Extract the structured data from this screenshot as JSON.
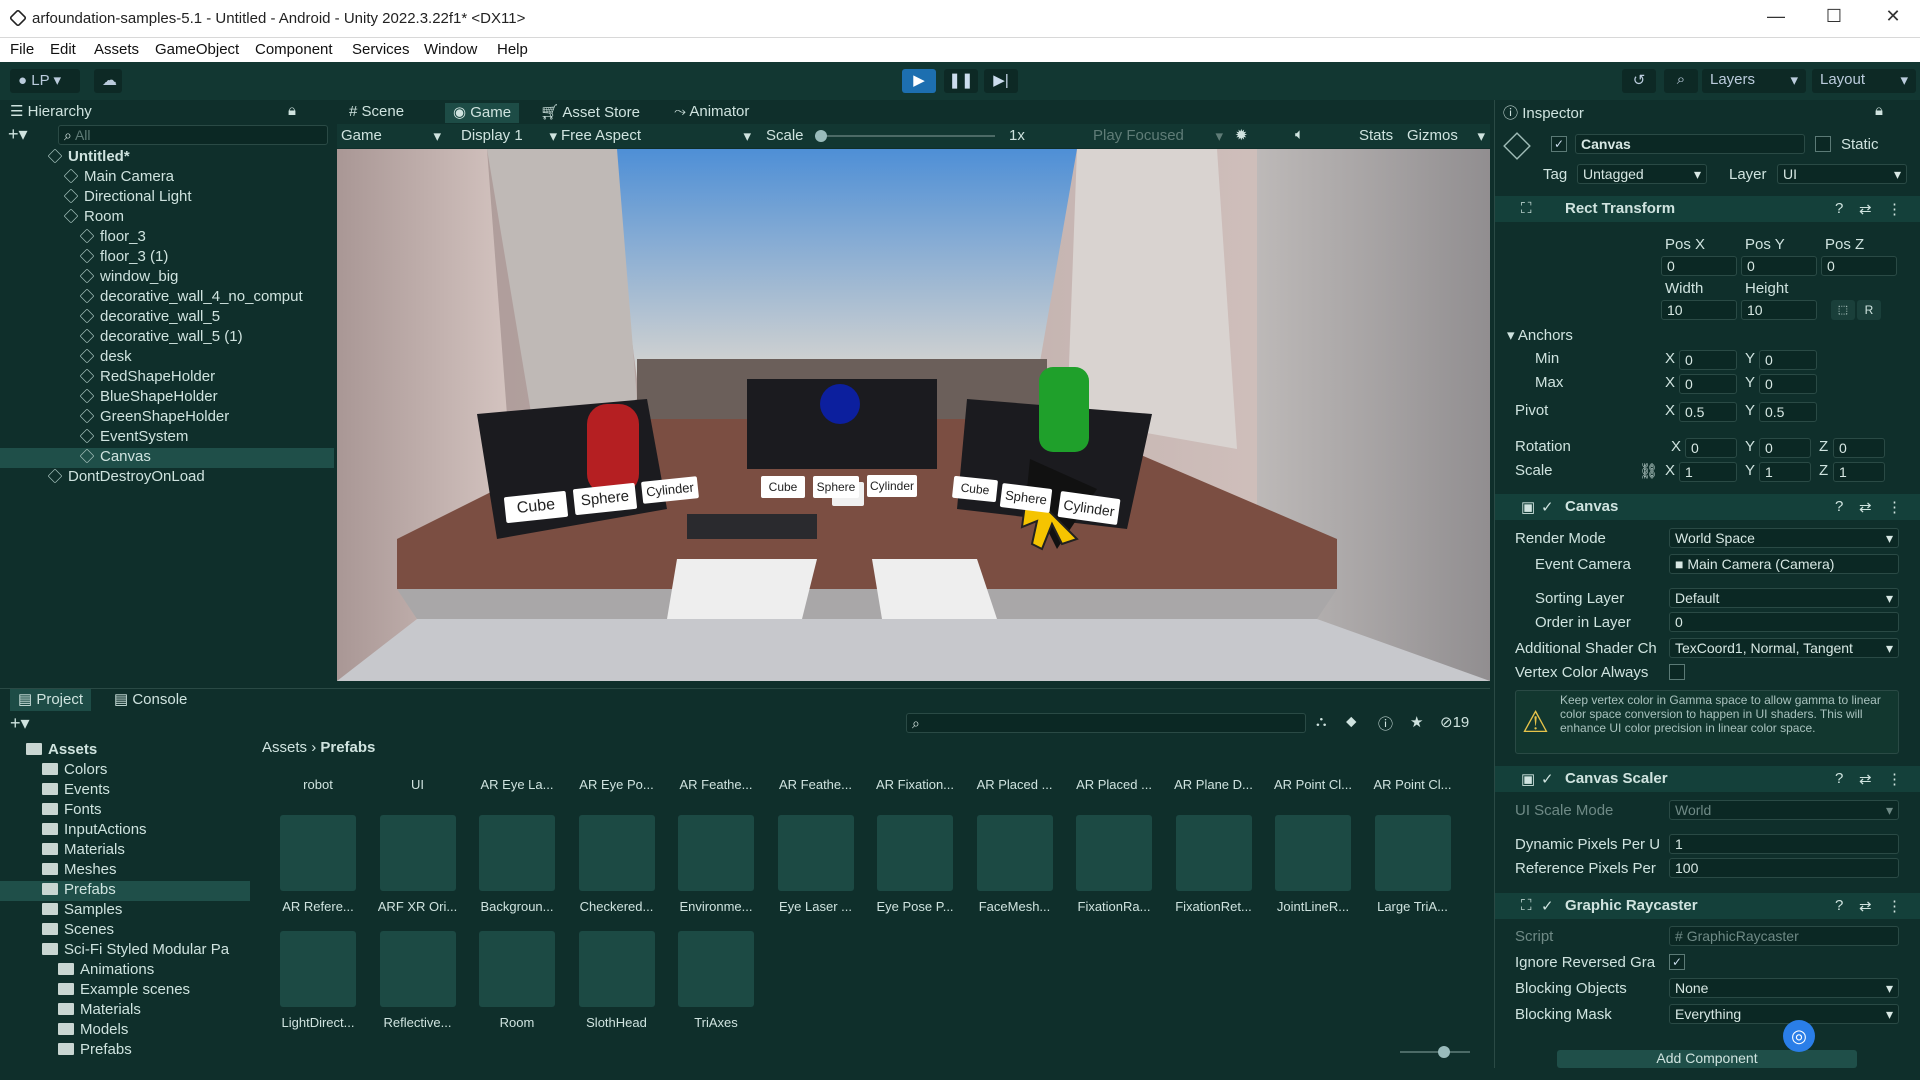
{
  "window": {
    "title": "arfoundation-samples-5.1 - Untitled - Android - Unity 2022.3.22f1* <DX11>",
    "minimize": "—",
    "maximize": "☐",
    "close": "✕"
  },
  "menu": [
    "File",
    "Edit",
    "Assets",
    "GameObject",
    "Component",
    "Services",
    "Window",
    "Help"
  ],
  "toolbar": {
    "account": "LP",
    "layers": "Layers",
    "layout": "Layout"
  },
  "hierarchy": {
    "title": "Hierarchy",
    "search_placeholder": "All",
    "items": [
      {
        "label": "Untitled*",
        "depth": 0
      },
      {
        "label": "Main Camera",
        "depth": 1
      },
      {
        "label": "Directional Light",
        "depth": 1
      },
      {
        "label": "Room",
        "depth": 1
      },
      {
        "label": "floor_3",
        "depth": 2
      },
      {
        "label": "floor_3 (1)",
        "depth": 2
      },
      {
        "label": "window_big",
        "depth": 2
      },
      {
        "label": "decorative_wall_4_no_comput",
        "depth": 2
      },
      {
        "label": "decorative_wall_5",
        "depth": 2
      },
      {
        "label": "decorative_wall_5 (1)",
        "depth": 2
      },
      {
        "label": "desk",
        "depth": 2
      },
      {
        "label": "RedShapeHolder",
        "depth": 2
      },
      {
        "label": "BlueShapeHolder",
        "depth": 2
      },
      {
        "label": "GreenShapeHolder",
        "depth": 2
      },
      {
        "label": "EventSystem",
        "depth": 2
      },
      {
        "label": "Canvas",
        "depth": 2
      },
      {
        "label": "DontDestroyOnLoad",
        "depth": 0
      }
    ]
  },
  "view_tabs": [
    "Scene",
    "Game",
    "Asset Store",
    "Animator"
  ],
  "game_toolbar": {
    "mode": "Game",
    "display": "Display 1",
    "aspect": "Free Aspect",
    "scale_label": "Scale",
    "scale_value": "1x",
    "play_focused": "Play Focused",
    "stats": "Stats",
    "gizmos": "Gizmos"
  },
  "game_view": {
    "left_buttons": [
      "Cube",
      "Sphere",
      "Cylinder"
    ],
    "center_buttons": [
      "Cube",
      "Sphere",
      "Cylinder"
    ],
    "right_buttons": [
      "Cube",
      "Sphere",
      "Cylinder"
    ]
  },
  "inspector": {
    "title": "Inspector",
    "object_name": "Canvas",
    "static_label": "Static",
    "tag_label": "Tag",
    "tag_value": "Untagged",
    "layer_label": "Layer",
    "layer_value": "UI",
    "rect_transform": {
      "title": "Rect Transform",
      "pos_x_label": "Pos X",
      "pos_y_label": "Pos Y",
      "pos_z_label": "Pos Z",
      "pos_x": "0",
      "pos_y": "0",
      "pos_z": "0",
      "width_label": "Width",
      "height_label": "Height",
      "width": "10",
      "height": "10",
      "anchors_label": "Anchors",
      "min_label": "Min",
      "min_x": "0",
      "min_y": "0",
      "max_label": "Max",
      "max_x": "0",
      "max_y": "0",
      "pivot_label": "Pivot",
      "pivot_x": "0.5",
      "pivot_y": "0.5",
      "rotation_label": "Rotation",
      "rot_x": "0",
      "rot_y": "0",
      "rot_z": "0",
      "scale_label": "Scale",
      "scale_x": "1",
      "scale_y": "1",
      "scale_z": "1",
      "r_button": "R"
    },
    "canvas": {
      "title": "Canvas",
      "render_mode_label": "Render Mode",
      "render_mode": "World Space",
      "event_camera_label": "Event Camera",
      "event_camera": "Main Camera (Camera)",
      "sorting_layer_label": "Sorting Layer",
      "sorting_layer": "Default",
      "order_label": "Order in Layer",
      "order": "0",
      "shader_label": "Additional Shader Ch",
      "shader": "TexCoord1, Normal, Tangent",
      "vertex_label": "Vertex Color Always",
      "warning": "Keep vertex color in Gamma space to allow gamma to linear color space conversion to happen in UI shaders. This will enhance UI color precision in linear color space."
    },
    "canvas_scaler": {
      "title": "Canvas Scaler",
      "mode_label": "UI Scale Mode",
      "mode": "World",
      "dyn_label": "Dynamic Pixels Per U",
      "dyn": "1",
      "ref_label": "Reference Pixels Per",
      "ref": "100"
    },
    "graphic_raycaster": {
      "title": "Graphic Raycaster",
      "script_label": "Script",
      "script": "GraphicRaycaster",
      "ignore_label": "Ignore Reversed Gra",
      "blocking_objects_label": "Blocking Objects",
      "blocking_objects": "None",
      "blocking_mask_label": "Blocking Mask",
      "blocking_mask": "Everything"
    },
    "add_component": "Add Component"
  },
  "project": {
    "tabs": [
      "Project",
      "Console"
    ],
    "hidden_count": "19",
    "breadcrumb": [
      "Assets",
      "Prefabs"
    ],
    "tree": [
      {
        "label": "Assets",
        "depth": 0
      },
      {
        "label": "Colors",
        "depth": 1
      },
      {
        "label": "Events",
        "depth": 1
      },
      {
        "label": "Fonts",
        "depth": 1
      },
      {
        "label": "InputActions",
        "depth": 1
      },
      {
        "label": "Materials",
        "depth": 1
      },
      {
        "label": "Meshes",
        "depth": 1
      },
      {
        "label": "Prefabs",
        "depth": 1
      },
      {
        "label": "Samples",
        "depth": 1
      },
      {
        "label": "Scenes",
        "depth": 1
      },
      {
        "label": "Sci-Fi Styled Modular Pa",
        "depth": 1
      },
      {
        "label": "Animations",
        "depth": 2
      },
      {
        "label": "Example scenes",
        "depth": 2
      },
      {
        "label": "Materials",
        "depth": 2
      },
      {
        "label": "Models",
        "depth": 2
      },
      {
        "label": "Prefabs",
        "depth": 2
      }
    ],
    "top_row": [
      "robot",
      "UI",
      "AR Eye La...",
      "AR Eye Po...",
      "AR Feathe...",
      "AR Feathe...",
      "AR Fixation...",
      "AR Placed ...",
      "AR Placed ...",
      "AR Plane D...",
      "AR Point Cl...",
      "AR Point Cl..."
    ],
    "row1": [
      "AR Refere...",
      "ARF XR Ori...",
      "Backgroun...",
      "Checkered...",
      "Environme...",
      "Eye Laser ...",
      "Eye Pose P...",
      "FaceMesh...",
      "FixationRa...",
      "FixationRet...",
      "JointLineR...",
      "Large TriA..."
    ],
    "row2": [
      "LightDirect...",
      "Reflective...",
      "Room",
      "SlothHead",
      "TriAxes"
    ]
  }
}
